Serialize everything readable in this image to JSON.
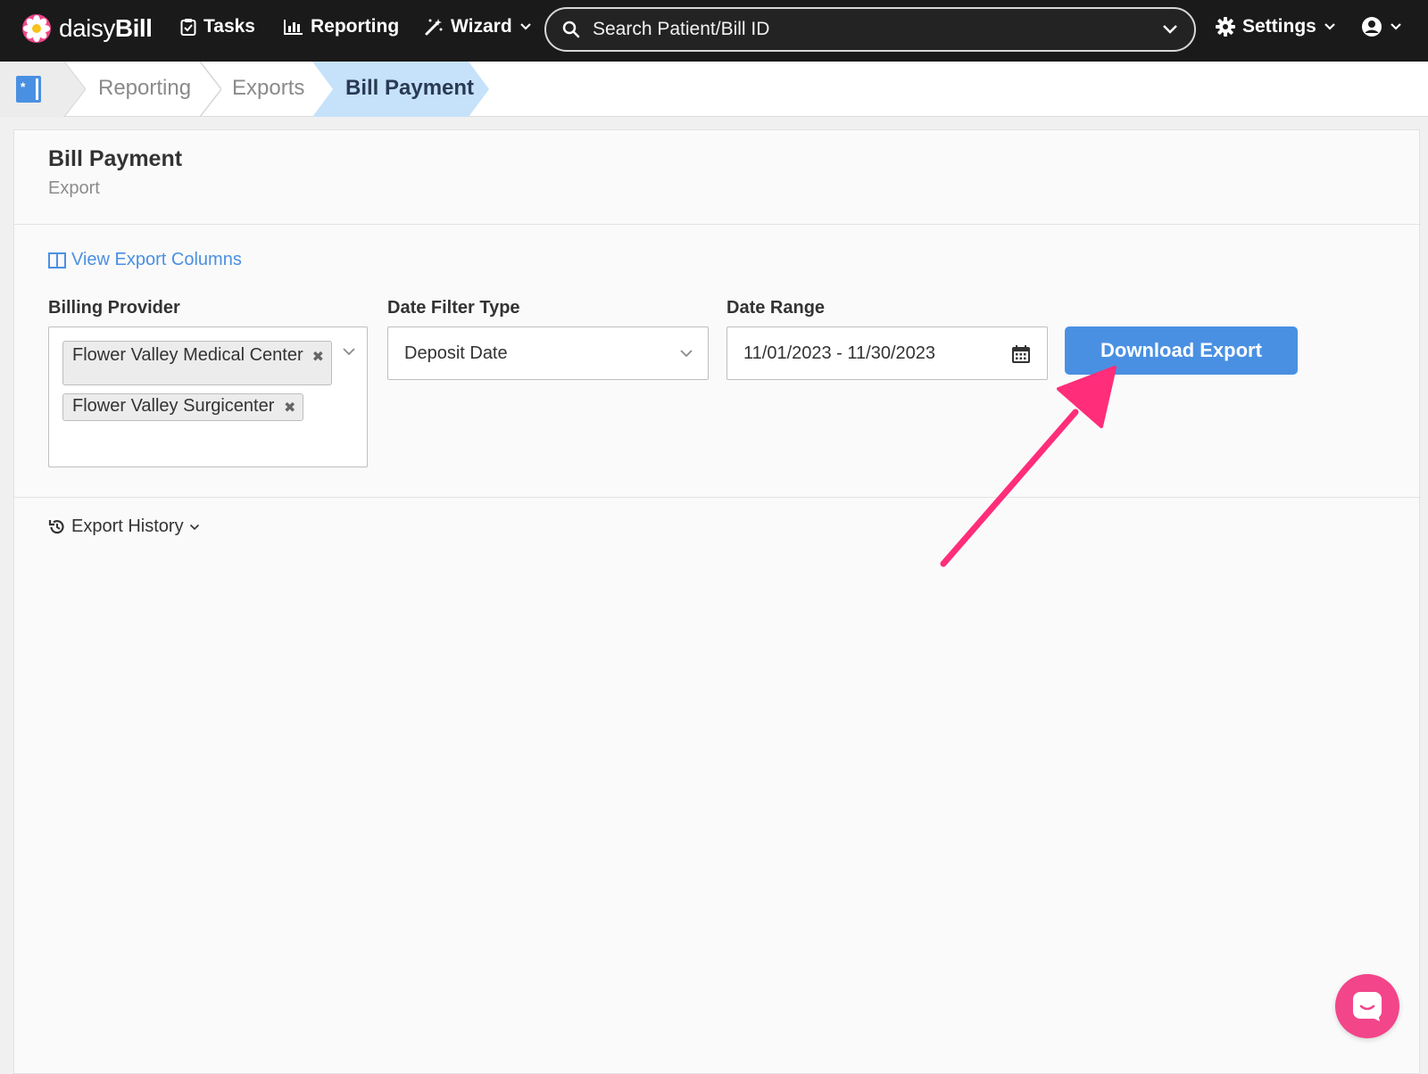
{
  "colors": {
    "topnav_bg": "#1a1a1a",
    "accent": "#4a90e2",
    "breadcrumb_active_bg": "#c6e2fb",
    "annotation_arrow": "#ff2d7a",
    "chat_bubble": "#f2458a"
  },
  "logo": {
    "text_light": "daisy",
    "text_bold": "Bill"
  },
  "topnav": {
    "tasks_label": "Tasks",
    "reporting_label": "Reporting",
    "wizard_label": "Wizard",
    "search_placeholder": "Search Patient/Bill ID",
    "settings_label": "Settings"
  },
  "breadcrumb": {
    "items": [
      "Reporting",
      "Exports",
      "Bill Payment"
    ]
  },
  "page": {
    "title": "Bill Payment",
    "subtitle": "Export",
    "view_columns_link": "View Export Columns"
  },
  "form": {
    "billing_provider": {
      "label": "Billing Provider",
      "selected": [
        "Flower Valley Medical Center",
        "Flower Valley Surgicenter"
      ]
    },
    "date_filter_type": {
      "label": "Date Filter Type",
      "value": "Deposit Date"
    },
    "date_range": {
      "label": "Date Range",
      "value": "11/01/2023 - 11/30/2023"
    },
    "download_button": "Download Export"
  },
  "export_history": {
    "label": "Export History"
  },
  "icons": {
    "logo": "daisy-flower-icon",
    "tasks": "clipboard-check-icon",
    "reporting": "bar-chart-icon",
    "wizard": "magic-wand-icon",
    "search": "search-icon",
    "settings": "gear-icon",
    "account": "user-circle-icon",
    "columns": "columns-icon",
    "calendar": "calendar-icon",
    "history": "history-icon",
    "chat": "chat-icon"
  }
}
